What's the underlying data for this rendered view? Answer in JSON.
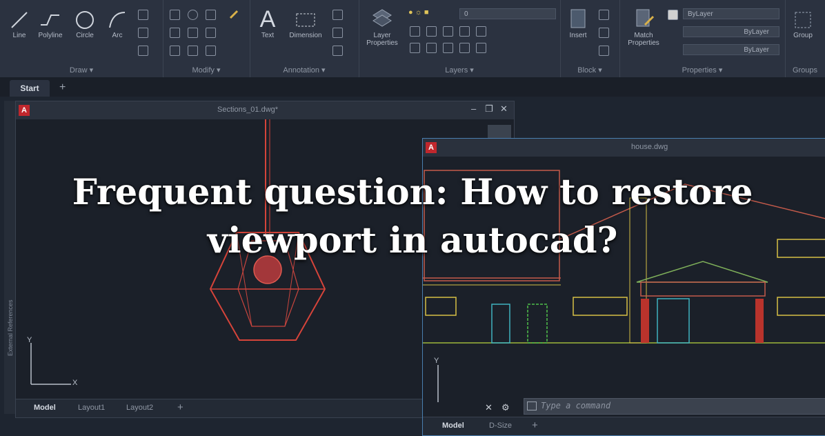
{
  "headline": {
    "line1": "Frequent question: How to restore",
    "line2": "viewport in autocad?"
  },
  "ribbon": {
    "draw": {
      "title": "Draw ▾",
      "tools": [
        "Line",
        "Polyline",
        "Circle",
        "Arc"
      ]
    },
    "modify": {
      "title": "Modify ▾"
    },
    "annotation": {
      "title": "Annotation ▾",
      "tools": [
        "Text",
        "Dimension"
      ]
    },
    "layers": {
      "title": "Layers ▾",
      "tool": "Layer Properties",
      "layer_value": "0"
    },
    "block": {
      "title": "Block ▾",
      "tool": "Insert"
    },
    "properties": {
      "title": "Properties ▾",
      "tool": "Match Properties",
      "fields": [
        "ByLayer",
        "ByLayer",
        "ByLayer"
      ]
    },
    "groups": {
      "title": "Groups",
      "tool": "Group"
    }
  },
  "tabs": {
    "start": "Start",
    "plus": "+"
  },
  "palette": {
    "label": "External References"
  },
  "window1": {
    "title": "Sections_01.dwg*",
    "model_tabs": [
      "Model",
      "Layout1",
      "Layout2",
      "+"
    ],
    "ucs_x": "X",
    "ucs_y": "Y"
  },
  "window2": {
    "title": "house.dwg",
    "model_tabs": [
      "Model",
      "D-Size",
      "+"
    ],
    "command_placeholder": "Type a command",
    "ucs_y": "Y"
  },
  "colors": {
    "ribbon": "#2b3240",
    "canvas": "#1b2029",
    "accent_red": "#c0272d"
  }
}
